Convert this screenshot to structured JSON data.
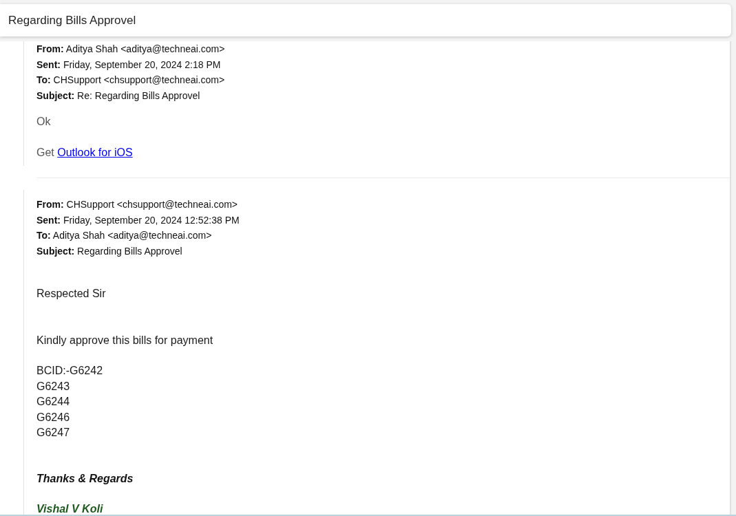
{
  "title": "Regarding Bills Approvel",
  "messages": [
    {
      "headers": [
        "**From:** Aditya Shah <aditya@techneai.com>",
        "**Sent:** Friday, September 20, 2024 2:18 PM",
        "**To:** CHSupport <chsupport@techneai.com>",
        "**Subject:** Re: Regarding Bills Approvel"
      ],
      "body": [
        {
          "kind": "light",
          "text": "Ok"
        },
        {
          "kind": "link_line",
          "text": "Get",
          "link": "Outlook for iOS"
        }
      ]
    },
    {
      "headers": [
        "**From:** CHSupport <chsupport@techneai.com>",
        "**Sent:** Friday, September 20, 2024 12:52:38 PM",
        "**To:** Aditya Shah <aditya@techneai.com>",
        "**Subject:** Regarding Bills Approvel"
      ],
      "body": [
        {
          "kind": "text",
          "lines": [
            "Respected Sir"
          ]
        },
        {
          "kind": "text",
          "lines": [
            "Kindly approve this bills for payment"
          ]
        },
        {
          "kind": "list",
          "lines": [
            "BCID:-G6242",
            "G6243",
            "G6244",
            "G6246",
            "G6247"
          ]
        },
        {
          "kind": "closing",
          "lines": [
            "Thanks & Regards"
          ]
        },
        {
          "kind": "signature",
          "lines": [
            "Vishal V Koli"
          ]
        }
      ]
    }
  ]
}
